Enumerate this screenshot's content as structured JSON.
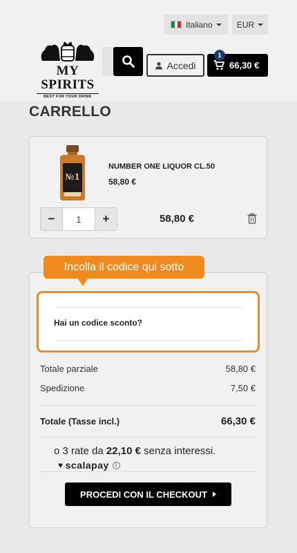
{
  "header": {
    "language": "Italiano",
    "currency": "EUR",
    "logo": {
      "name": "MY SPIRITS",
      "tagline": "BEST FOR YOUR DRINK"
    },
    "login_label": "Accedi",
    "cart_total": "66,30 €",
    "cart_count": "1",
    "icons": [
      "flag-italy-icon",
      "search-icon",
      "user-icon",
      "cart-icon"
    ]
  },
  "page": {
    "title": "CARRELLO"
  },
  "cart": {
    "items": [
      {
        "name": "NUMBER ONE LIQUOR CL.50",
        "price": "58,80 €",
        "quantity": "1",
        "total": "58,80 €"
      }
    ]
  },
  "promo": {
    "tooltip": "Incolla il codice qui sotto",
    "label": "Hai un codice sconto?"
  },
  "summary": {
    "subtotal_label": "Totale parziale",
    "subtotal_value": "58,80 €",
    "shipping_label": "Spedizione",
    "shipping_value": "7,50 €",
    "total_label": "Totale (Tasse incl.)",
    "total_value": "66,30 €"
  },
  "installments": {
    "prefix": "o 3 rate da ",
    "amount": "22,10 €",
    "suffix": " senza interessi.",
    "provider": "scalapay"
  },
  "checkout": {
    "label": "PROCEDI CON IL CHECKOUT"
  },
  "colors": {
    "accent": "#ef8a1f",
    "primary": "#000000",
    "badge": "#1e3a6e"
  }
}
